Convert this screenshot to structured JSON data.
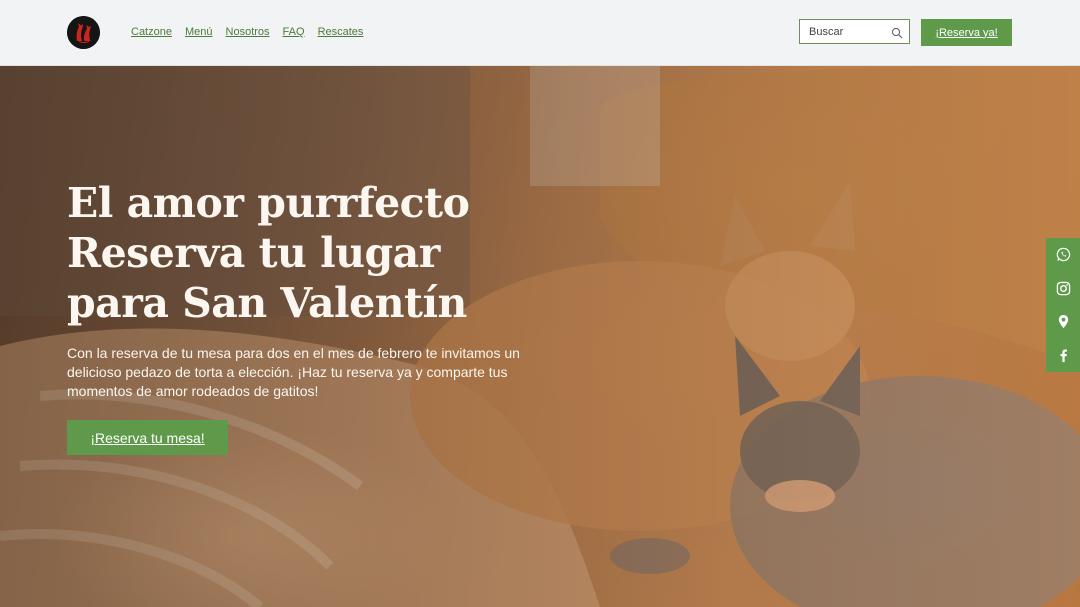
{
  "header": {
    "logo_icon": "cats-logo-icon",
    "nav": [
      {
        "label": "Catzone"
      },
      {
        "label": "Menú"
      },
      {
        "label": "Nosotros"
      },
      {
        "label": "FAQ"
      },
      {
        "label": "Rescates"
      }
    ],
    "search": {
      "placeholder": "Buscar",
      "icon": "search-icon"
    },
    "reserve_label": "¡Reserva ya!"
  },
  "hero": {
    "title_lines": [
      "El amor purrfecto",
      "Reserva tu lugar",
      "para San Valentín"
    ],
    "description": "Con la reserva de tu mesa para dos en el mes de febrero te invitamos un delicioso pedazo de torta a elección. ¡Haz tu reserva ya y comparte tus momentos de amor rodeados de gatitos!",
    "cta_label": "¡Reserva tu mesa!"
  },
  "social": [
    {
      "icon": "whatsapp-icon"
    },
    {
      "icon": "instagram-icon"
    },
    {
      "icon": "location-pin-icon"
    },
    {
      "icon": "facebook-icon"
    }
  ],
  "colors": {
    "accent": "#5f9a4a",
    "nav_link": "#4e7a3b",
    "header_bg": "#f2f3f4",
    "hero_text": "#fbf6ef"
  }
}
